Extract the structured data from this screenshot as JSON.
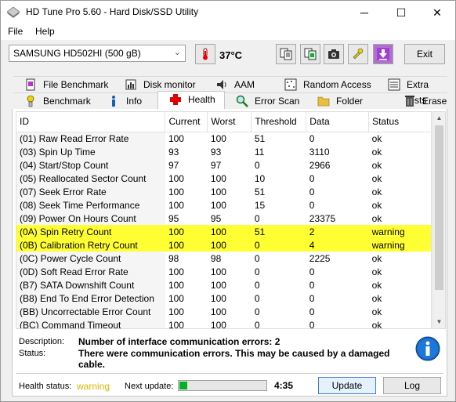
{
  "window": {
    "title": "HD Tune Pro 5.60 - Hard Disk/SSD Utility",
    "minimize": "─",
    "maximize": "☐",
    "close": "✕"
  },
  "menu": {
    "file": "File",
    "help": "Help"
  },
  "toolbar": {
    "drive": "SAMSUNG HD502HI (500 gB)",
    "temperature": "37°C",
    "exit_label": "Exit"
  },
  "tabs_top": [
    {
      "label": "File Benchmark",
      "icon": "file-benchmark-icon"
    },
    {
      "label": "Disk monitor",
      "icon": "disk-monitor-icon"
    },
    {
      "label": "AAM",
      "icon": "aam-icon"
    },
    {
      "label": "Random Access",
      "icon": "random-access-icon"
    },
    {
      "label": "Extra tests",
      "icon": "extra-tests-icon"
    }
  ],
  "tabs_bottom": [
    {
      "label": "Benchmark",
      "icon": "benchmark-icon"
    },
    {
      "label": "Info",
      "icon": "info-icon"
    },
    {
      "label": "Health",
      "icon": "health-cross-icon"
    },
    {
      "label": "Error Scan",
      "icon": "error-scan-icon"
    },
    {
      "label": "Folder Usage",
      "icon": "folder-icon"
    },
    {
      "label": "Erase",
      "icon": "erase-icon"
    }
  ],
  "table": {
    "columns": [
      "ID",
      "Current",
      "Worst",
      "Threshold",
      "Data",
      "Status"
    ],
    "rows": [
      {
        "id": "(01) Raw Read Error Rate",
        "current": "100",
        "worst": "100",
        "threshold": "51",
        "data": "0",
        "status": "ok",
        "warning": false
      },
      {
        "id": "(03) Spin Up Time",
        "current": "93",
        "worst": "93",
        "threshold": "11",
        "data": "3110",
        "status": "ok",
        "warning": false
      },
      {
        "id": "(04) Start/Stop Count",
        "current": "97",
        "worst": "97",
        "threshold": "0",
        "data": "2966",
        "status": "ok",
        "warning": false
      },
      {
        "id": "(05) Reallocated Sector Count",
        "current": "100",
        "worst": "100",
        "threshold": "10",
        "data": "0",
        "status": "ok",
        "warning": false
      },
      {
        "id": "(07) Seek Error Rate",
        "current": "100",
        "worst": "100",
        "threshold": "51",
        "data": "0",
        "status": "ok",
        "warning": false
      },
      {
        "id": "(08) Seek Time Performance",
        "current": "100",
        "worst": "100",
        "threshold": "15",
        "data": "0",
        "status": "ok",
        "warning": false
      },
      {
        "id": "(09) Power On Hours Count",
        "current": "95",
        "worst": "95",
        "threshold": "0",
        "data": "23375",
        "status": "ok",
        "warning": false
      },
      {
        "id": "(0A) Spin Retry Count",
        "current": "100",
        "worst": "100",
        "threshold": "51",
        "data": "2",
        "status": "warning",
        "warning": true
      },
      {
        "id": "(0B) Calibration Retry Count",
        "current": "100",
        "worst": "100",
        "threshold": "0",
        "data": "4",
        "status": "warning",
        "warning": true
      },
      {
        "id": "(0C) Power Cycle Count",
        "current": "98",
        "worst": "98",
        "threshold": "0",
        "data": "2225",
        "status": "ok",
        "warning": false
      },
      {
        "id": "(0D) Soft Read Error Rate",
        "current": "100",
        "worst": "100",
        "threshold": "0",
        "data": "0",
        "status": "ok",
        "warning": false
      },
      {
        "id": "(B7) SATA Downshift Count",
        "current": "100",
        "worst": "100",
        "threshold": "0",
        "data": "0",
        "status": "ok",
        "warning": false
      },
      {
        "id": "(B8) End To End Error Detection",
        "current": "100",
        "worst": "100",
        "threshold": "0",
        "data": "0",
        "status": "ok",
        "warning": false
      },
      {
        "id": "(BB) Uncorrectable Error Count",
        "current": "100",
        "worst": "100",
        "threshold": "0",
        "data": "0",
        "status": "ok",
        "warning": false
      },
      {
        "id": "(BC) Command Timeout",
        "current": "100",
        "worst": "100",
        "threshold": "0",
        "data": "0",
        "status": "ok",
        "warning": false
      }
    ]
  },
  "details": {
    "description_label": "Description:",
    "description": "Number of interface communication errors: 2",
    "status_label": "Status:",
    "status_line1": "There were communication errors. This may be caused by a damaged",
    "status_line2": "cable."
  },
  "footer": {
    "health_label": "Health status:",
    "health_value": "warning",
    "next_label": "Next update:",
    "progress": 0.09,
    "time": "4:35",
    "update_label": "Update",
    "log_label": "Log"
  },
  "colors": {
    "warning_highlight": "#ffff33",
    "warning_text": "#d6b800",
    "progress_fill": "#06b025"
  }
}
